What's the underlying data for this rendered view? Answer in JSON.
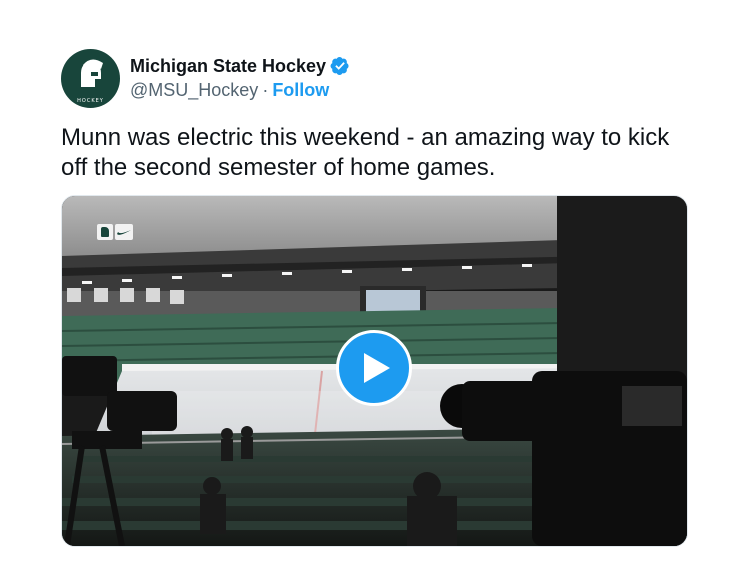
{
  "author": {
    "display_name": "Michigan State Hockey",
    "handle": "@MSU_Hockey",
    "separator": "·",
    "follow_label": "Follow",
    "verified": true,
    "avatar_text": "HOCKEY"
  },
  "tweet": {
    "text_line1": "Munn was electric this weekend - an amazing way to kick",
    "text_line2": "off the second semester of home games."
  },
  "media": {
    "type": "video",
    "play_icon": "play-icon",
    "badge_icons": [
      "spartan-logo-icon",
      "nike-swoosh-icon"
    ]
  },
  "colors": {
    "accent": "#1d9bf0",
    "text": "#0f1419",
    "secondary": "#536471",
    "brand_green": "#18453b"
  }
}
